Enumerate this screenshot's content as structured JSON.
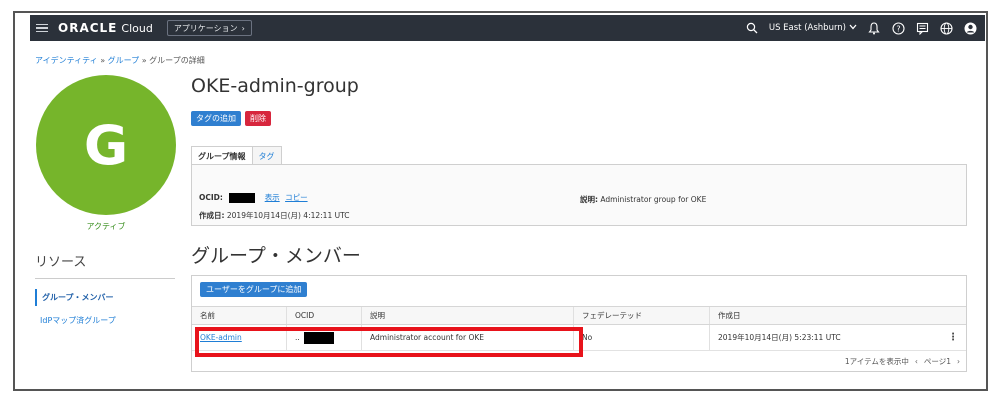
{
  "topbar": {
    "brand": "ORACLE",
    "brand_suffix": "Cloud",
    "apps_label": "アプリケーション",
    "region": "US East (Ashburn)"
  },
  "breadcrumb": {
    "items": [
      "アイデンティティ",
      "グループ",
      "グループの詳細"
    ],
    "separator": "»"
  },
  "avatar": {
    "letter": "G",
    "status": "アクティブ"
  },
  "resources": {
    "title": "リソース",
    "items": [
      "グループ・メンバー",
      "IdPマップ済グループ"
    ]
  },
  "group": {
    "name": "OKE-admin-group",
    "add_tag_label": "タグの追加",
    "delete_label": "削除"
  },
  "tabs": [
    "グループ情報",
    "タグ"
  ],
  "info": {
    "ocid_label": "OCID:",
    "show_label": "表示",
    "copy_label": "コピー",
    "created_label": "作成日:",
    "created_value": "2019年10月14日(月) 4:12:11 UTC",
    "desc_label": "説明:",
    "desc_value": "Administrator group for OKE"
  },
  "members": {
    "title": "グループ・メンバー",
    "add_user_label": "ユーザーをグループに追加",
    "columns": [
      "名前",
      "OCID",
      "説明",
      "フェデレーテッド",
      "作成日"
    ],
    "rows": [
      {
        "name": "OKE-admin",
        "ocid_prefix": "..",
        "description": "Administrator account for OKE",
        "federated": "No",
        "created": "2019年10月14日(月) 5:23:11 UTC"
      }
    ],
    "footer_count": "1アイテムを表示中",
    "footer_page": "ページ1"
  },
  "colors": {
    "topbar": "#2b313a",
    "avatar": "#76b52b",
    "primary": "#2f7fd0",
    "danger": "#d7263d",
    "highlight": "#e8131b"
  }
}
